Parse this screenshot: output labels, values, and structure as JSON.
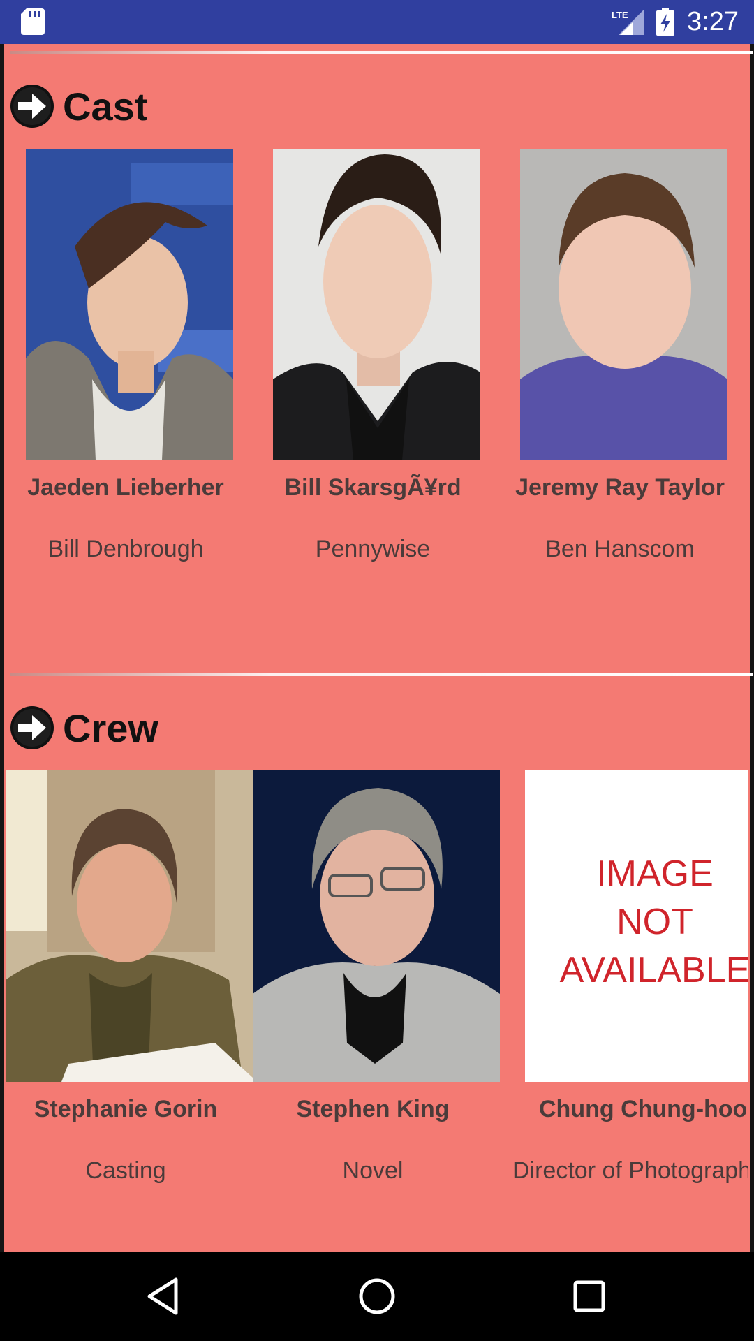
{
  "status_bar": {
    "time": "3:27",
    "network": "LTE",
    "icons": [
      "sd-card-icon",
      "signal-icon",
      "battery-charging-icon"
    ]
  },
  "cast": {
    "title": "Cast",
    "members": [
      {
        "name": "Jaeden Lieberher",
        "role": "Bill Denbrough"
      },
      {
        "name": "Bill SkarsgÃ¥rd",
        "role": "Pennywise"
      },
      {
        "name": "Jeremy Ray Taylor",
        "role": "Ben Hanscom"
      }
    ]
  },
  "crew": {
    "title": "Crew",
    "members": [
      {
        "name": "Stephanie Gorin",
        "role": "Casting"
      },
      {
        "name": "Stephen King",
        "role": "Novel"
      },
      {
        "name": "Chung Chung-hoon",
        "role": "Director of Photography",
        "placeholder_lines": [
          "IMAGE",
          "NOT",
          "AVAILABLE"
        ]
      }
    ]
  },
  "colors": {
    "status_bar": "#303F9F",
    "background": "#F47A73",
    "placeholder_text": "#D0242B"
  },
  "nav_bar": {
    "icons": [
      "back-icon",
      "home-icon",
      "recents-icon"
    ]
  }
}
